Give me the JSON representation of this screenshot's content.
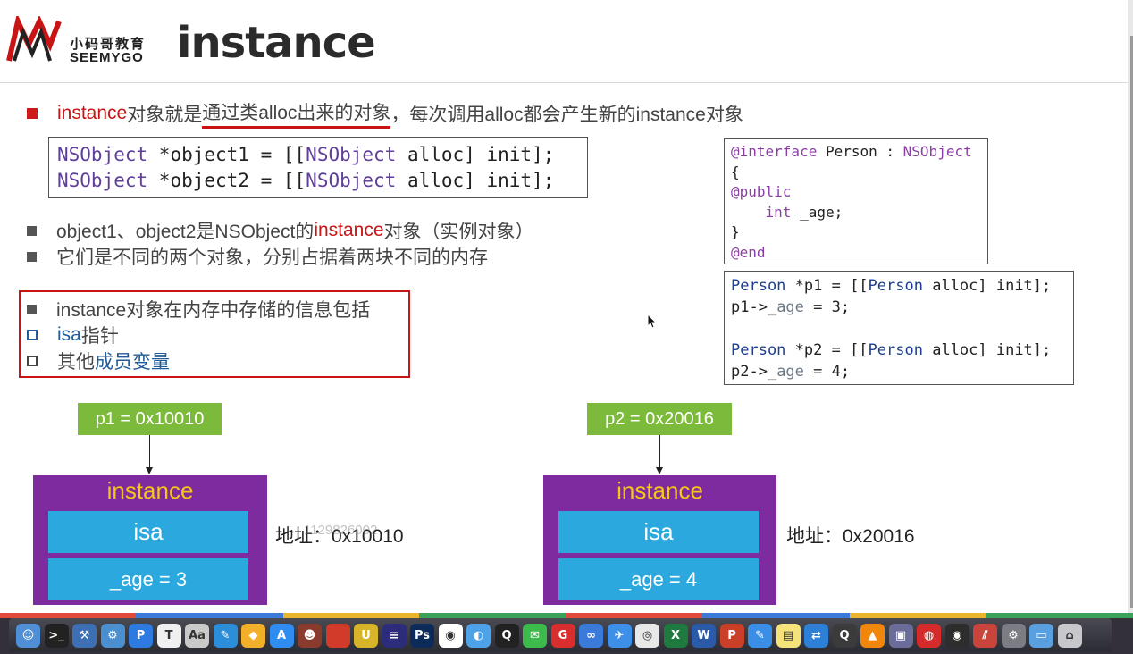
{
  "logo": {
    "cn": "小码哥教育",
    "en": "SEEMYGO"
  },
  "title": "instance",
  "bullet1": {
    "p1": "instance",
    "p2": "对象就是",
    "p3": "通过类alloc出来的对象",
    "p4": "，每次调用alloc都会产生新的instance对象"
  },
  "code_main": {
    "l1": [
      "NSObject",
      " *object1 = [[",
      "NSObject",
      " alloc] init];"
    ],
    "l2": [
      "NSObject",
      " *object2 = [[",
      "NSObject",
      " alloc] init];"
    ]
  },
  "bullet2": {
    "p1": "object1、object2是NSObject的",
    "p2": "instance",
    "p3": "对象（实例对象）"
  },
  "bullet3": "它们是不同的两个对象，分别占据着两块不同的内存",
  "info": {
    "title": "instance对象在内存中存储的信息包括",
    "isa": "isa",
    "isa_suffix": "指针",
    "other_prefix": "其他",
    "other": "成员变量"
  },
  "code_person": {
    "l1a": "@interface",
    "l1b": " Person : ",
    "l1c": "NSObject",
    "l2": "{",
    "l3": "@public",
    "l4a": "    int",
    "l4b": " _age;",
    "l5": "}",
    "l6": "@end"
  },
  "code_p": {
    "l1a": "Person",
    "l1b": " *p1 = [[",
    "l1c": "Person",
    "l1d": " alloc] init];",
    "l2a": "p1->",
    "l2b": "_age",
    "l2c": " = 3;",
    "l3a": "Person",
    "l3b": " *p2 = [[",
    "l3c": "Person",
    "l3d": " alloc] init];",
    "l4a": "p2->",
    "l4b": "_age",
    "l4c": " = 4;"
  },
  "diagram": {
    "left": {
      "ptr": "p1 = 0x10010",
      "title": "instance",
      "isa": "isa",
      "age": "_age = 3",
      "addr": "地址：0x10010"
    },
    "right": {
      "ptr": "p2 = 0x20016",
      "title": "instance",
      "isa": "isa",
      "age": "_age = 4",
      "addr": "地址：0x20016"
    }
  },
  "watermark": "1129826002",
  "colors": {
    "accent_red": "#c81414",
    "purple": "#7d2b9e",
    "green": "#7cba3b",
    "cyan": "#2ba9df",
    "gold": "#f5c518"
  },
  "dock": {
    "icons": [
      "finder-icon",
      "terminal-icon",
      "xcode-icon",
      "instruments-icon",
      "preview-icon",
      "textedit-icon",
      "font-book-icon",
      "pages-icon",
      "sketch-icon",
      "app-store-icon",
      "avatar-app-icon",
      "apple-icon",
      "ue-icon",
      "vscode-icon",
      "photoshop-icon",
      "github-icon",
      "browser-icon",
      "qq-icon",
      "wechat-icon",
      "netease-icon",
      "baidu-icon",
      "feishu-icon",
      "chrome-icon",
      "excel-icon",
      "word-icon",
      "powerpoint-icon",
      "notes-icon",
      "stickies-icon",
      "teamviewer-icon",
      "quicktime-icon",
      "vlc-icon",
      "media-icon",
      "netease-music-icon",
      "audio-icon",
      "parallels-icon",
      "system-prefs-icon",
      "folder-icon",
      "trash-icon"
    ],
    "glyphs": [
      "☺",
      ">_",
      "⚒",
      "⚙",
      "P",
      "T",
      "Aa",
      "✎",
      "◆",
      "A",
      "☻",
      "",
      "U",
      "≡",
      "Ps",
      "◉",
      "◐",
      "Q",
      "✉",
      "G",
      "∞",
      "✈",
      "◎",
      "X",
      "W",
      "P",
      "✎",
      "▤",
      "⇄",
      "Q",
      "▲",
      "▣",
      "◍",
      "◉",
      "⫽",
      "⚙",
      "▭",
      "⌂"
    ],
    "bg": [
      "#4f8fd8",
      "#222222",
      "#3c6fb3",
      "#4a90d0",
      "#2d7be0",
      "#f0f0f0",
      "#c9c9c9",
      "#2c8ed8",
      "#f2b02a",
      "#2f8cf0",
      "#8a3b2e",
      "#d23b2a",
      "#d8b42a",
      "#2c2c7a",
      "#0c2b5a",
      "#ffffff",
      "#4ea3e8",
      "#222222",
      "#3cba4c",
      "#d82e2e",
      "#3b7ad8",
      "#3d8fe8",
      "#e8e8e8",
      "#1f7a3f",
      "#2a5aa8",
      "#c93f28",
      "#3a8ee6",
      "#f5e27a",
      "#2e7fd6",
      "#3b3b3b",
      "#f0860a",
      "#6c6c9a",
      "#d52b2b",
      "#2d2d2d",
      "#c9443a",
      "#7c7c84",
      "#5aa0e0",
      "#c8c8cc"
    ]
  }
}
